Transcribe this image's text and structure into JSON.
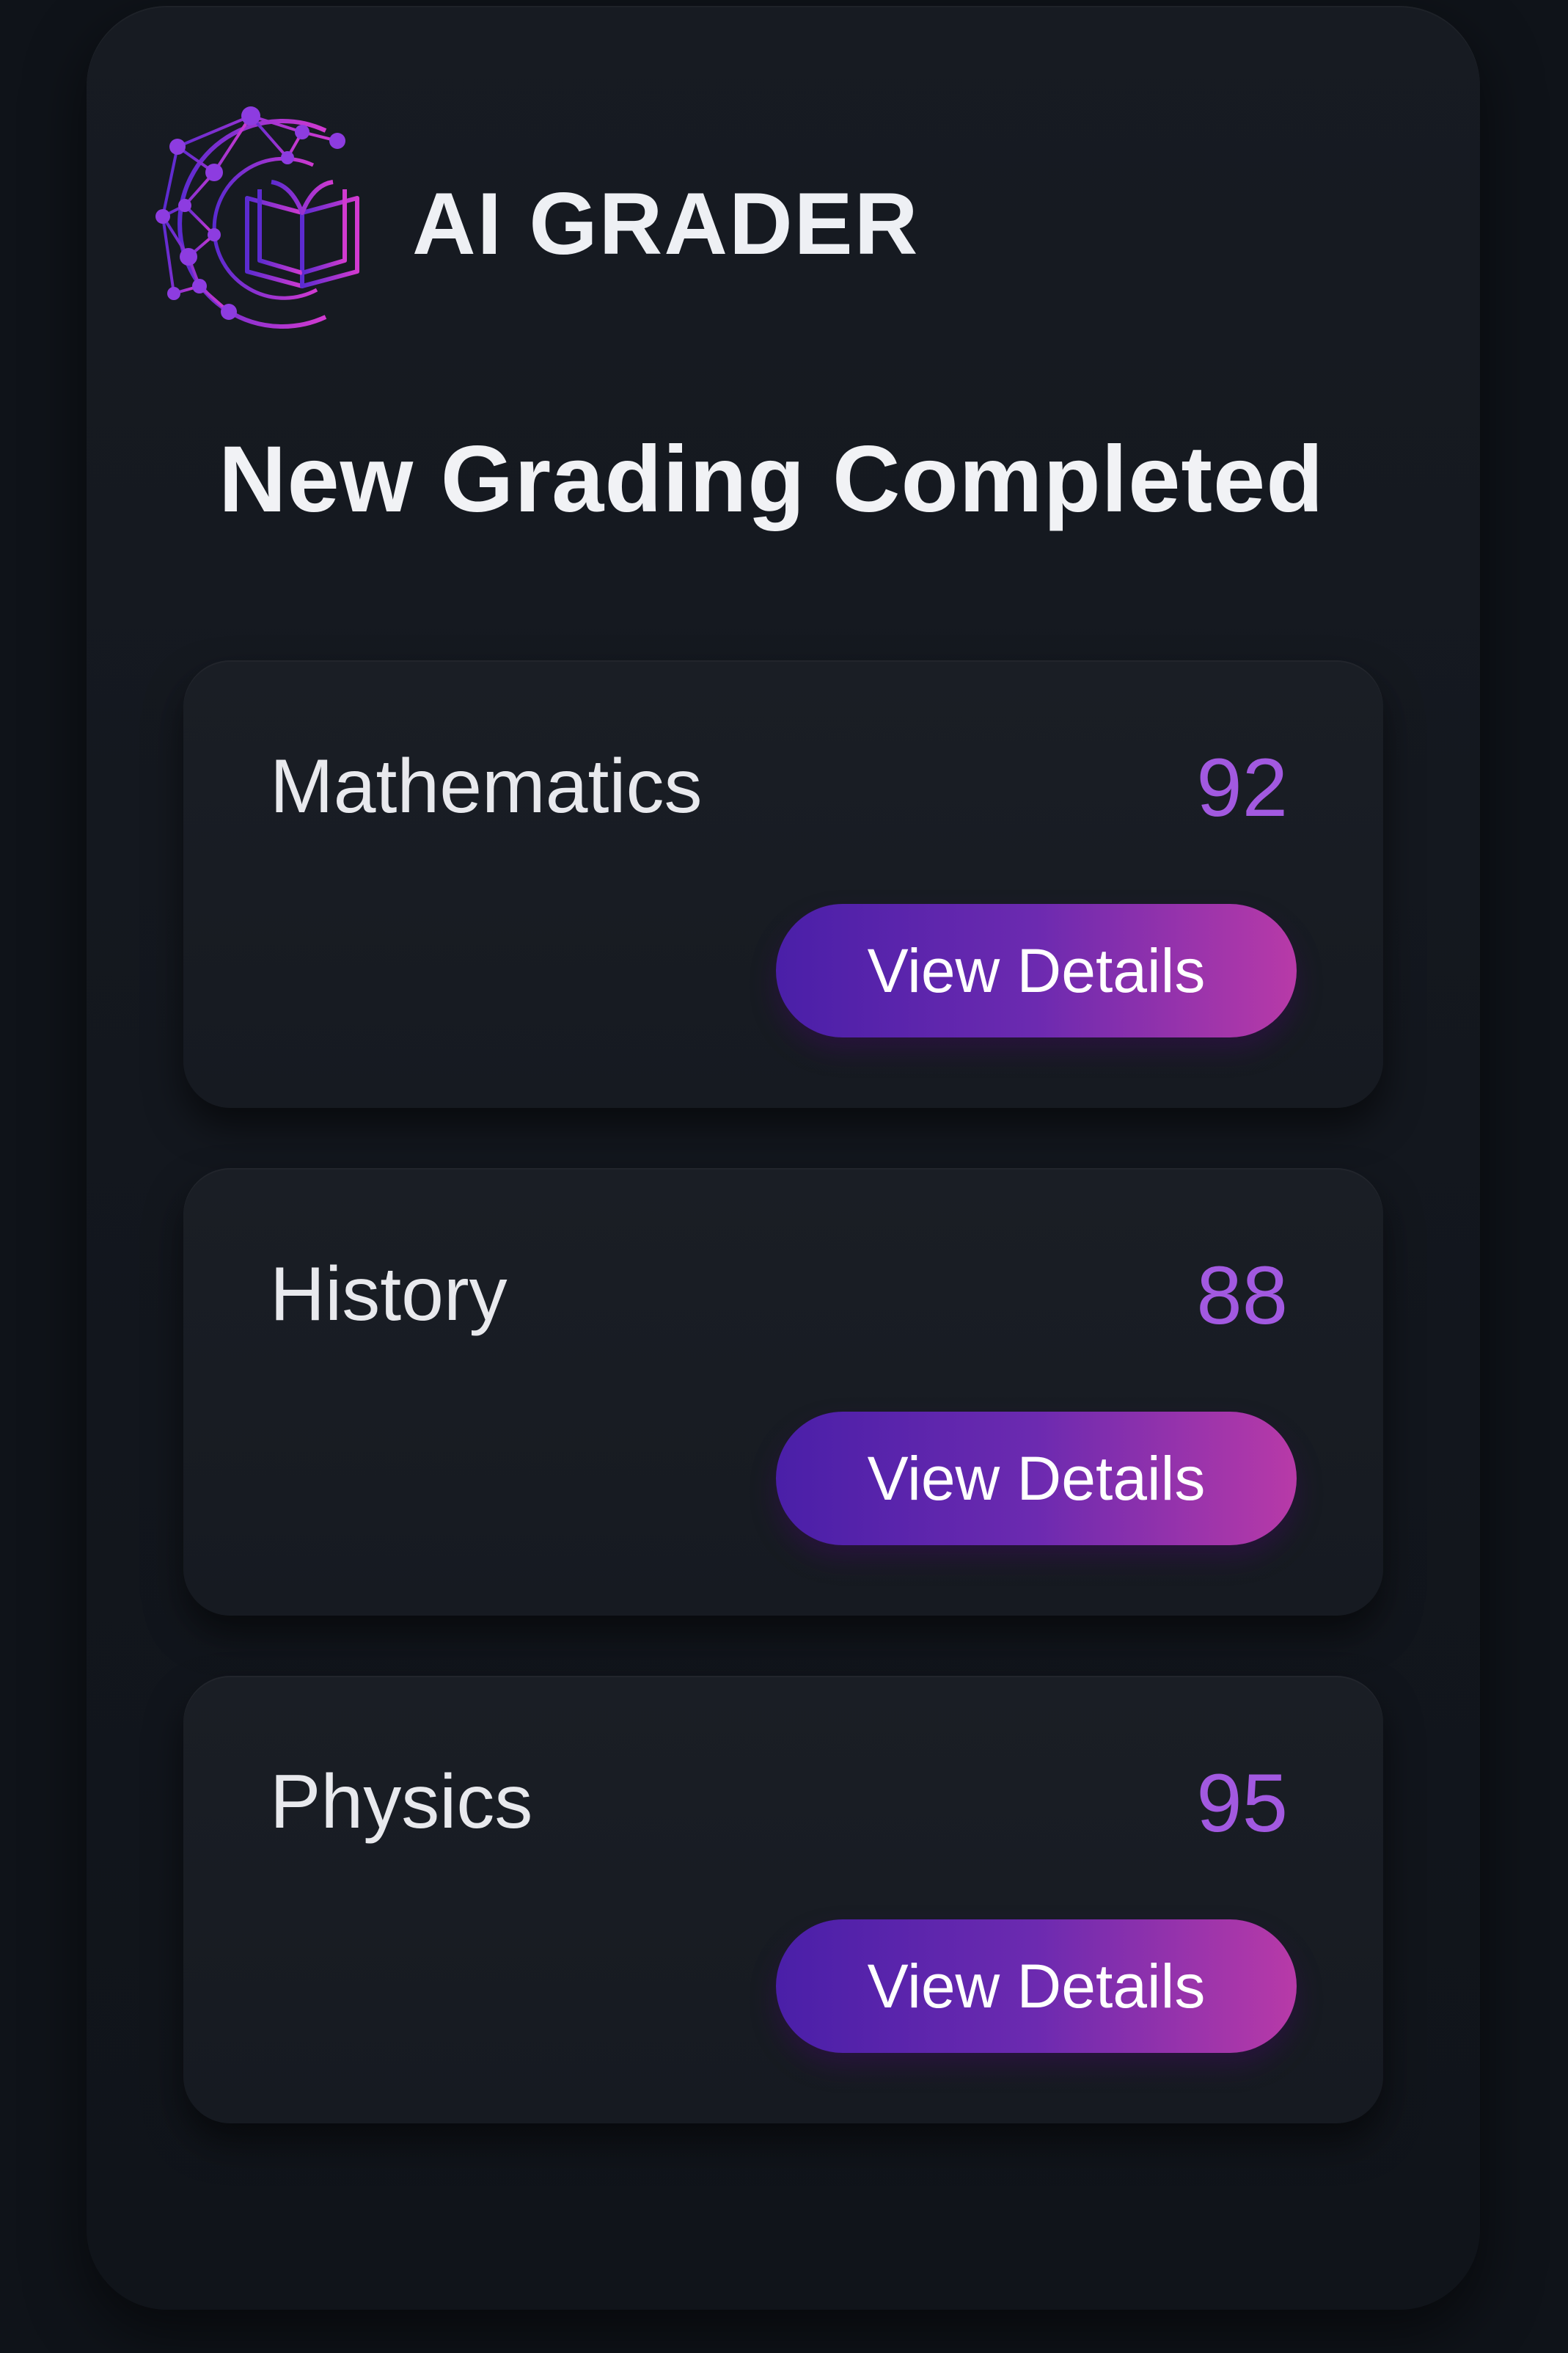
{
  "brand": {
    "name": "AI GRADER",
    "logo_icon": "circuit-book-icon"
  },
  "page_title": "New Grading Completed",
  "colors": {
    "background": "#0f1319",
    "card": "#181c23",
    "score": "#a259e0",
    "button_gradient_start": "#4a1fa8",
    "button_gradient_end": "#b83aa8"
  },
  "results": [
    {
      "subject": "Mathematics",
      "score": "92",
      "button_label": "View Details"
    },
    {
      "subject": "History",
      "score": "88",
      "button_label": "View Details"
    },
    {
      "subject": "Physics",
      "score": "95",
      "button_label": "View Details"
    }
  ]
}
